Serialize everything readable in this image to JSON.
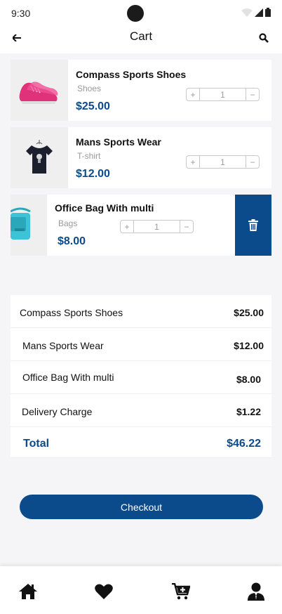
{
  "status_bar": {
    "time": "9:30"
  },
  "app_bar": {
    "title": "Cart",
    "back_icon": "arrow-left-icon",
    "search_icon": "search-icon"
  },
  "cart_items": [
    {
      "name": "Compass Sports Shoes",
      "category": "Shoes",
      "price": "$25.00",
      "quantity": "1",
      "minus": "−",
      "plus": "+"
    },
    {
      "name": "Mans Sports Wear",
      "category": "T-shirt",
      "price": "$12.00",
      "quantity": "1",
      "minus": "−",
      "plus": "+"
    },
    {
      "name": "Office Bag With multi",
      "category": "Bags",
      "price": "$8.00",
      "quantity": "1",
      "minus": "−",
      "plus": "+"
    }
  ],
  "summary": {
    "rows": [
      {
        "label": "Compass Sports Shoes",
        "value": "$25.00"
      },
      {
        "label": "Mans Sports Wear",
        "value": "$12.00"
      },
      {
        "label": "Office Bag With multi",
        "value": "$8.00"
      },
      {
        "label": "Delivery Charge",
        "value": "$1.22"
      }
    ],
    "total_label": "Total",
    "total_value": "$46.22"
  },
  "checkout_label": "Checkout",
  "colors": {
    "accent": "#0b4a8b",
    "background": "#f5f5f7"
  },
  "bottom_nav": [
    "home-icon",
    "heart-icon",
    "cart-add-icon",
    "user-icon"
  ]
}
